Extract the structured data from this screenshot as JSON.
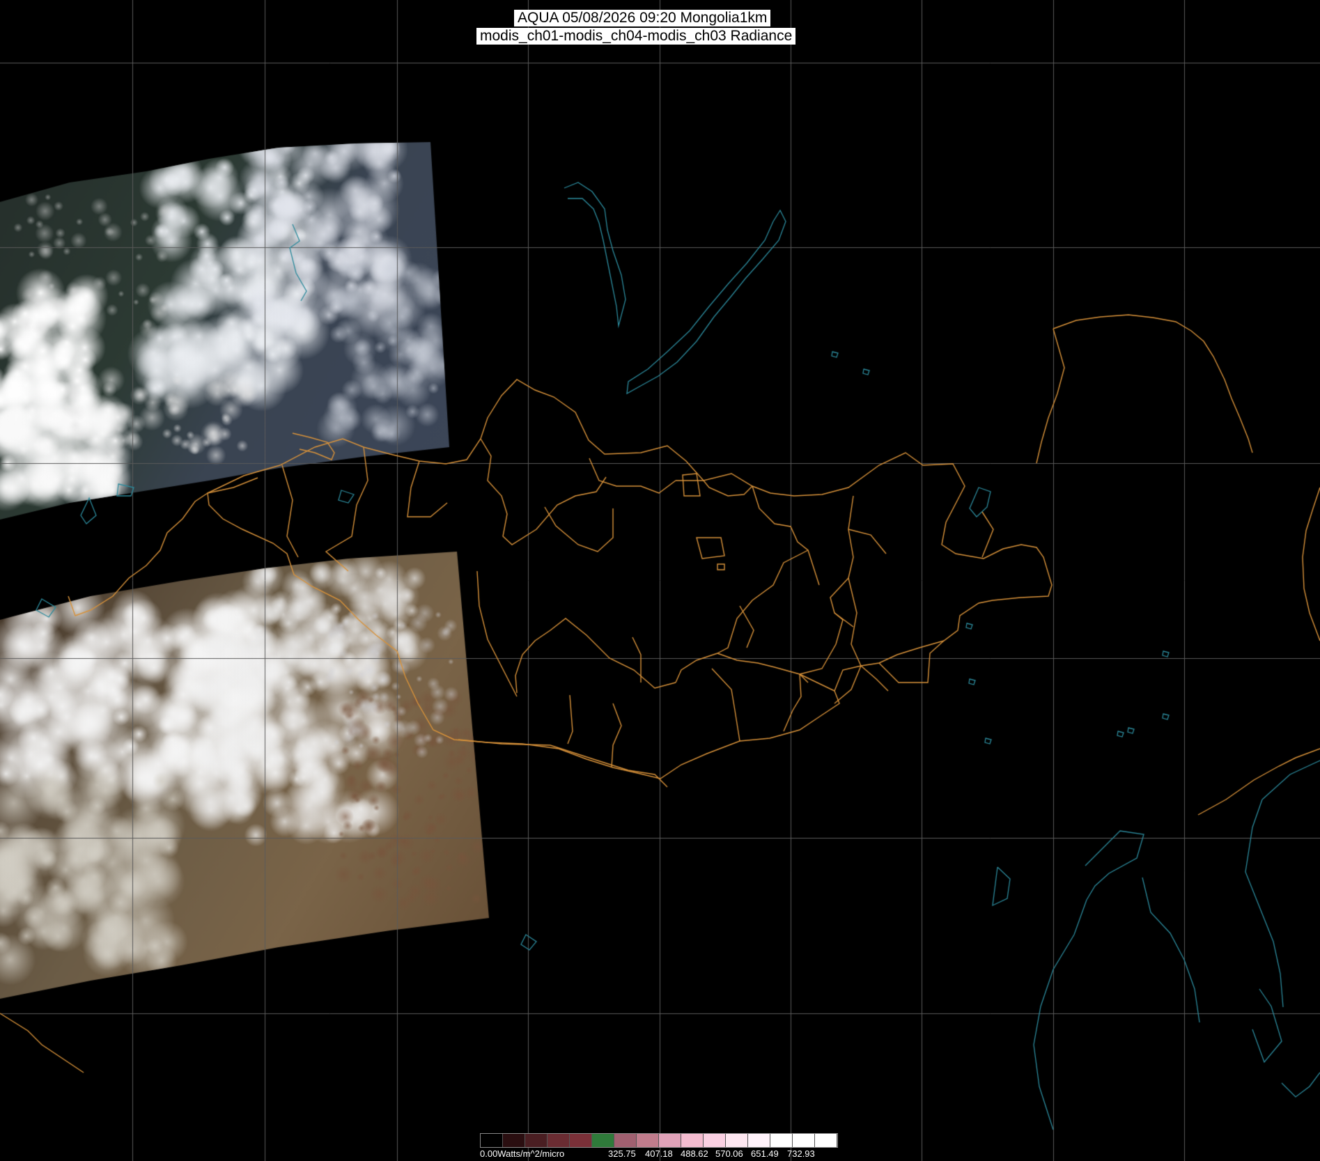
{
  "title": {
    "line1": "AQUA 05/08/2026 09:20 Mongolia1km",
    "line2": "modis_ch01-modis_ch04-modis_ch03 Radiance"
  },
  "legend": {
    "ticks": [
      "0.00Watts/m^2/micro",
      "325.75",
      "407.18",
      "488.62",
      "570.06",
      "651.49",
      "732.93"
    ],
    "colors": [
      "#000000",
      "#2a0e10",
      "#4a1e22",
      "#6a2c32",
      "#7a3038",
      "#2f7a3a",
      "#a06070",
      "#c07c8c",
      "#e0a2b8",
      "#f4bcd0",
      "#fad0e2",
      "#fde6f0",
      "#fff2fa",
      "#ffffff",
      "#ffffff",
      "#ffffff"
    ]
  },
  "map": {
    "background_color": "#000000",
    "graticule_color": "#5a5a5a",
    "border_color": "#d8923a",
    "coastline_color": "#2c8a9c"
  }
}
